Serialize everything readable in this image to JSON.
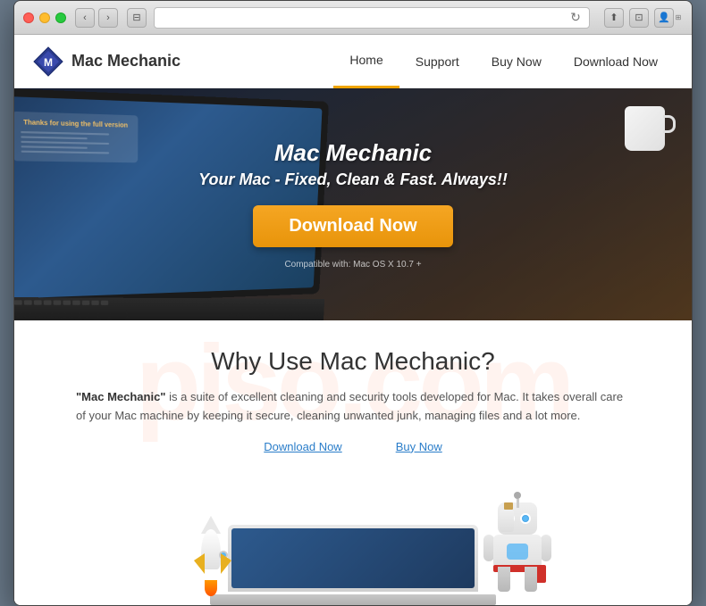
{
  "browser": {
    "address": "",
    "back_label": "‹",
    "forward_label": "›",
    "reload_label": "↻",
    "share_label": "⬆",
    "tab_label": "⊡",
    "profile_label": "👤",
    "resize_label": "⊞"
  },
  "nav": {
    "logo_text": "Mac Mechanic",
    "links": [
      {
        "label": "Home",
        "active": true
      },
      {
        "label": "Support",
        "active": false
      },
      {
        "label": "Buy Now",
        "active": false
      },
      {
        "label": "Download Now",
        "active": false
      }
    ]
  },
  "hero": {
    "title": "Mac Mechanic",
    "subtitle": "Your Mac - Fixed, Clean & Fast. Always!!",
    "download_button": "Download Now",
    "compat_text": "Compatible with: Mac OS X 10.7 +",
    "screen_note_title": "Thanks for using the full version",
    "screen_note_lines": [
      "Keep Your Mac Clean & Clutter Free",
      "Boost System Performance & Startup Speed",
      "Remove Duplicate Files & Recover Disk Space"
    ]
  },
  "why_section": {
    "title": "Why Use Mac Mechanic?",
    "description_start": "\"Mac Mechanic\"",
    "description_rest": " is a suite of excellent cleaning and security tools developed for Mac. It takes overall care of your Mac machine by keeping it secure, cleaning unwanted junk, managing files and a lot more.",
    "link_download": "Download Now",
    "link_buy": "Buy Now",
    "watermark": "piso.com"
  }
}
